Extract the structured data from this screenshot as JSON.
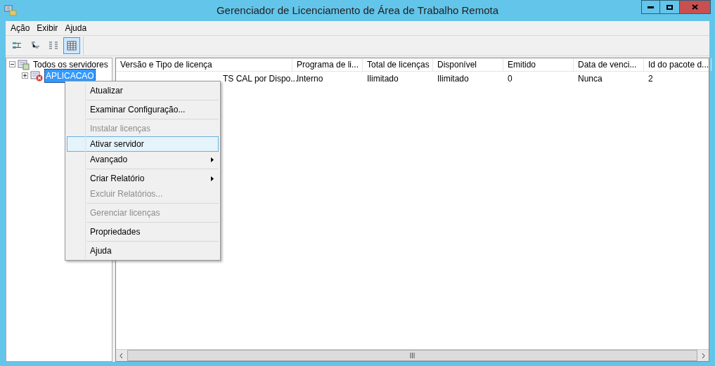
{
  "window": {
    "title": "Gerenciador de Licenciamento de Área de Trabalho Remota"
  },
  "menubar": [
    "Ação",
    "Exibir",
    "Ajuda"
  ],
  "toolbar": [
    {
      "selected": false
    },
    {
      "selected": false
    },
    {
      "selected": false
    },
    {
      "selected": true
    }
  ],
  "tree": [
    {
      "label": "Todos os servidores",
      "expanded": true,
      "selected": false,
      "error": false,
      "children": [
        {
          "label": "APLICACAO",
          "expanded": false,
          "selected": true,
          "error": true
        }
      ]
    }
  ],
  "table": {
    "columns": [
      "Versão e Tipo de licença",
      "Programa de li...",
      "Total de licenças",
      "Disponível",
      "Emitido",
      "Data de venci...",
      "Id do pacote d..."
    ],
    "rows": [
      [
        "TS CAL por Dispo...",
        "Interno",
        "Ilimitado",
        "Ilimitado",
        "0",
        "Nunca",
        "2"
      ]
    ]
  },
  "context_menu": [
    {
      "kind": "item",
      "label": "Atualizar",
      "disabled": false,
      "selected": false,
      "submenu": false
    },
    {
      "kind": "separator"
    },
    {
      "kind": "item",
      "label": "Examinar Configuração...",
      "disabled": false,
      "selected": false,
      "submenu": false
    },
    {
      "kind": "separator"
    },
    {
      "kind": "item",
      "label": "Instalar licenças",
      "disabled": true,
      "selected": false,
      "submenu": false
    },
    {
      "kind": "item",
      "label": "Ativar servidor",
      "disabled": false,
      "selected": true,
      "submenu": false
    },
    {
      "kind": "item",
      "label": "Avançado",
      "disabled": false,
      "selected": false,
      "submenu": true
    },
    {
      "kind": "separator"
    },
    {
      "kind": "item",
      "label": "Criar Relatório",
      "disabled": false,
      "selected": false,
      "submenu": true
    },
    {
      "kind": "item",
      "label": "Excluir Relatórios...",
      "disabled": true,
      "selected": false,
      "submenu": false
    },
    {
      "kind": "separator"
    },
    {
      "kind": "item",
      "label": "Gerenciar licenças",
      "disabled": true,
      "selected": false,
      "submenu": false
    },
    {
      "kind": "separator"
    },
    {
      "kind": "item",
      "label": "Propriedades",
      "disabled": false,
      "selected": false,
      "submenu": false
    },
    {
      "kind": "separator"
    },
    {
      "kind": "item",
      "label": "Ajuda",
      "disabled": false,
      "selected": false,
      "submenu": false
    }
  ]
}
